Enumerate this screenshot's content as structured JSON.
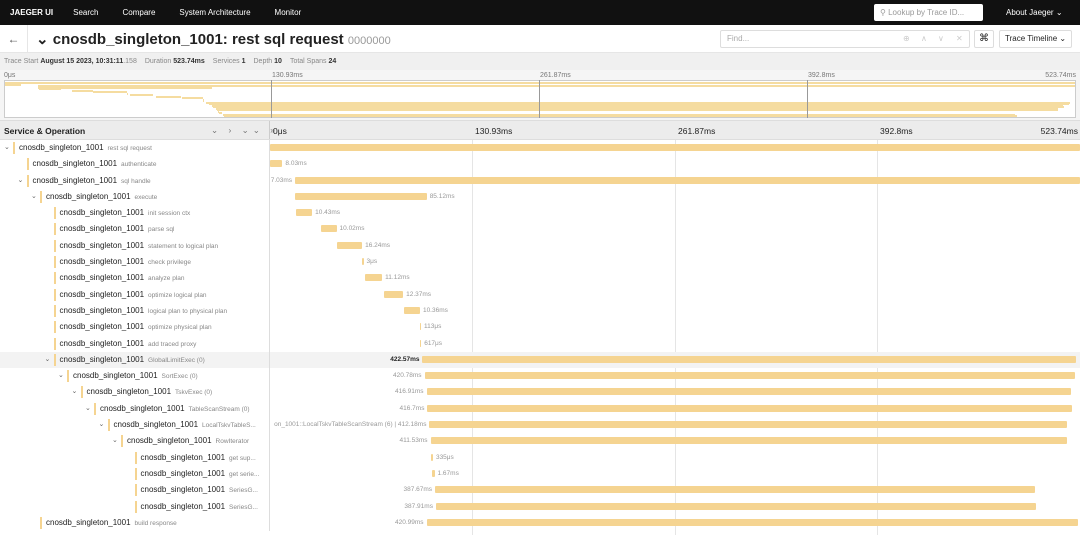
{
  "nav": {
    "brand": "JAEGER UI",
    "items": [
      "Search",
      "Compare",
      "System Architecture",
      "Monitor"
    ],
    "lookup_placeholder": "Lookup by Trace ID...",
    "about": "About Jaeger ⌄"
  },
  "title": {
    "service": "cnosdb_singleton_1001: rest sql request",
    "trace_id": "0000000",
    "find_placeholder": "Find...",
    "view": "Trace Timeline ⌄"
  },
  "info": {
    "start_label": "Trace Start",
    "start": "August 15 2023, 10:31:11",
    "start_ms": ".158",
    "duration_label": "Duration",
    "duration": "523.74ms",
    "services_label": "Services",
    "services": "1",
    "depth_label": "Depth",
    "depth": "10",
    "spans_label": "Total Spans",
    "spans": "24"
  },
  "ticks": [
    "0μs",
    "130.93ms",
    "261.87ms",
    "392.8ms",
    "523.74ms"
  ],
  "colhead": {
    "title": "Service & Operation",
    "controls": "⌄ › ⌄⌄ »"
  },
  "total_ms": 523.74,
  "colors": {
    "bar": "#f5d491"
  },
  "spans": [
    {
      "svc": "cnosdb_singleton_1001",
      "op": "rest sql request",
      "depth": 0,
      "chev": true,
      "start": 0,
      "dur": 523.74,
      "label": ""
    },
    {
      "svc": "cnosdb_singleton_1001",
      "op": "authenticate",
      "depth": 1,
      "chev": false,
      "start": 0,
      "dur": 8.03,
      "label": "8.03ms"
    },
    {
      "svc": "cnosdb_singleton_1001",
      "op": "sql handle",
      "depth": 1,
      "chev": true,
      "start": 16.2,
      "dur": 507.5,
      "label": "7.03ms"
    },
    {
      "svc": "cnosdb_singleton_1001",
      "op": "execute",
      "depth": 2,
      "chev": true,
      "start": 16.2,
      "dur": 85.12,
      "label": "85.12ms"
    },
    {
      "svc": "cnosdb_singleton_1001",
      "op": "init session ctx",
      "depth": 3,
      "chev": false,
      "start": 16.8,
      "dur": 10.43,
      "label": "10.43ms"
    },
    {
      "svc": "cnosdb_singleton_1001",
      "op": "parse sql",
      "depth": 3,
      "chev": false,
      "start": 33,
      "dur": 10.02,
      "label": "10.02ms"
    },
    {
      "svc": "cnosdb_singleton_1001",
      "op": "statement to logical plan",
      "depth": 3,
      "chev": false,
      "start": 43.3,
      "dur": 16.24,
      "label": "16.24ms"
    },
    {
      "svc": "cnosdb_singleton_1001",
      "op": "check privilege",
      "depth": 3,
      "chev": false,
      "start": 59.5,
      "dur": 0.003,
      "label": "3μs"
    },
    {
      "svc": "cnosdb_singleton_1001",
      "op": "analyze plan",
      "depth": 3,
      "chev": false,
      "start": 61.4,
      "dur": 11.12,
      "label": "11.12ms"
    },
    {
      "svc": "cnosdb_singleton_1001",
      "op": "optimize logical plan",
      "depth": 3,
      "chev": false,
      "start": 73.7,
      "dur": 12.37,
      "label": "12.37ms"
    },
    {
      "svc": "cnosdb_singleton_1001",
      "op": "logical plan to physical plan",
      "depth": 3,
      "chev": false,
      "start": 86.6,
      "dur": 10.36,
      "label": "10.36ms"
    },
    {
      "svc": "cnosdb_singleton_1001",
      "op": "optimize physical plan",
      "depth": 3,
      "chev": false,
      "start": 96.7,
      "dur": 0.113,
      "label": "113μs"
    },
    {
      "svc": "cnosdb_singleton_1001",
      "op": "add traced proxy",
      "depth": 3,
      "chev": false,
      "start": 96.8,
      "dur": 0.617,
      "label": "617μs"
    },
    {
      "svc": "cnosdb_singleton_1001",
      "op": "GlobalLimitExec (0)",
      "depth": 3,
      "chev": true,
      "start": 98.6,
      "dur": 422.57,
      "label": "422.57ms",
      "hl": true
    },
    {
      "svc": "cnosdb_singleton_1001",
      "op": "SortExec (0)",
      "depth": 4,
      "chev": true,
      "start": 99.9,
      "dur": 420.78,
      "label": "420.78ms"
    },
    {
      "svc": "cnosdb_singleton_1001",
      "op": "TskvExec (0)",
      "depth": 5,
      "chev": true,
      "start": 101.2,
      "dur": 416.91,
      "label": "416.91ms"
    },
    {
      "svc": "cnosdb_singleton_1001",
      "op": "TableScanStream (0)",
      "depth": 6,
      "chev": true,
      "start": 101.8,
      "dur": 416.7,
      "label": "416.7ms"
    },
    {
      "svc": "cnosdb_singleton_1001",
      "op": "LocalTskvTableS...",
      "depth": 7,
      "chev": true,
      "start": 103.1,
      "dur": 412.18,
      "label": "on_1001::LocalTskvTableScanStream (6) | 412.18ms"
    },
    {
      "svc": "cnosdb_singleton_1001",
      "op": "RowIterator",
      "depth": 8,
      "chev": true,
      "start": 103.8,
      "dur": 411.53,
      "label": "411.53ms"
    },
    {
      "svc": "cnosdb_singleton_1001",
      "op": "get sup...",
      "depth": 9,
      "chev": false,
      "start": 104.4,
      "dur": 0.335,
      "label": "335μs"
    },
    {
      "svc": "cnosdb_singleton_1001",
      "op": "get serie...",
      "depth": 9,
      "chev": false,
      "start": 104.7,
      "dur": 1.67,
      "label": "1.67ms"
    },
    {
      "svc": "cnosdb_singleton_1001",
      "op": "SeriesG...",
      "depth": 9,
      "chev": false,
      "start": 106.7,
      "dur": 387.67,
      "label": "387.67ms"
    },
    {
      "svc": "cnosdb_singleton_1001",
      "op": "SeriesG...",
      "depth": 9,
      "chev": false,
      "start": 107.3,
      "dur": 387.91,
      "label": "387.91ms"
    },
    {
      "svc": "cnosdb_singleton_1001",
      "op": "build response",
      "depth": 2,
      "chev": false,
      "start": 101.2,
      "dur": 420.99,
      "label": "420.99ms"
    }
  ]
}
